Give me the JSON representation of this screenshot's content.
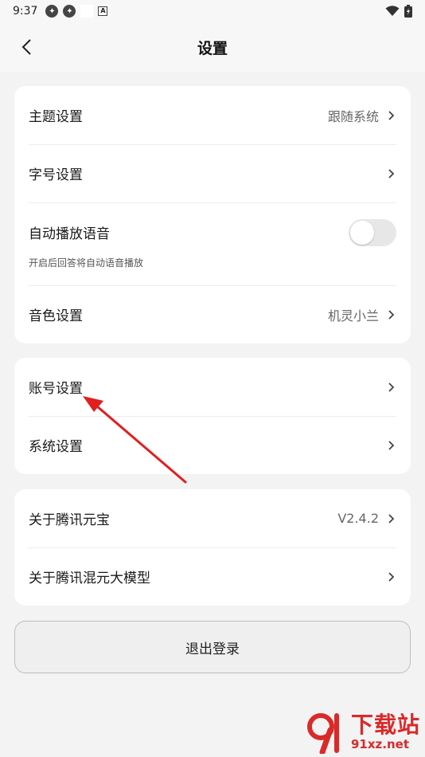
{
  "status_bar": {
    "time": "9:37"
  },
  "header": {
    "title": "设置"
  },
  "group1": {
    "theme": {
      "label": "主题设置",
      "value": "跟随系统"
    },
    "font": {
      "label": "字号设置"
    },
    "auto_voice": {
      "label": "自动播放语音",
      "sub": "开启后回答将自动语音播放",
      "enabled": false
    },
    "timbre": {
      "label": "音色设置",
      "value": "机灵小兰"
    }
  },
  "group2": {
    "account": {
      "label": "账号设置"
    },
    "system": {
      "label": "系统设置"
    }
  },
  "group3": {
    "about_app": {
      "label": "关于腾讯元宝",
      "value": "V2.4.2"
    },
    "about_model": {
      "label": "关于腾讯混元大模型"
    }
  },
  "logout": {
    "label": "退出登录"
  },
  "watermark": {
    "text": "下载站",
    "url": "91xz.net"
  },
  "colors": {
    "accent_arrow": "#e02020",
    "watermark": "#d92a2a"
  }
}
